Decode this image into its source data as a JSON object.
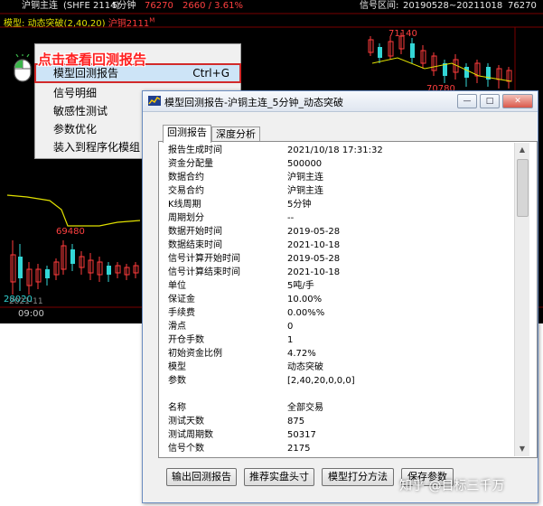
{
  "chart": {
    "symbol": "沪铜主连",
    "contract": "(SHFE 2114)",
    "period": "5分钟",
    "price": "76270",
    "change": "2660 / 3.61%",
    "signal_range_label": "信号区间:",
    "signal_range": "20190528~20211018",
    "last_price": "76270",
    "model_prefix": "模型:",
    "model_name": "动态突破(2,40,20)",
    "model_value": "沪铜2111",
    "model_suffix": "M",
    "price_high": "71140",
    "price_mid": "69480",
    "price_right_low": "70780",
    "price_bottom": "28020",
    "date_small": "2021-11",
    "time_label": "09:00"
  },
  "context_menu": {
    "items": [
      {
        "label": "模型回测报告",
        "shortcut": "Ctrl+G"
      },
      {
        "label": "信号明细",
        "shortcut": ""
      },
      {
        "label": "敏感性测试",
        "shortcut": ""
      },
      {
        "label": "参数优化",
        "shortcut": ""
      },
      {
        "label": "装入到程序化模组",
        "shortcut": ""
      }
    ]
  },
  "callout": {
    "text": "点击查看回测报告"
  },
  "window": {
    "title": "模型回测报告-沪铜主连_5分钟_动态突破",
    "tabs": [
      "回测报告",
      "深度分析"
    ],
    "rows": [
      {
        "k": "报告生成时间",
        "v": "2021/10/18 17:31:32"
      },
      {
        "k": "资金分配量",
        "v": "500000"
      },
      {
        "k": "数据合约",
        "v": "沪铜主连"
      },
      {
        "k": "交易合约",
        "v": "沪铜主连"
      },
      {
        "k": "K线周期",
        "v": "5分钟"
      },
      {
        "k": "周期划分",
        "v": "--"
      },
      {
        "k": "数据开始时间",
        "v": "2019-05-28"
      },
      {
        "k": "数据结束时间",
        "v": "2021-10-18"
      },
      {
        "k": "信号计算开始时间",
        "v": "2019-05-28"
      },
      {
        "k": "信号计算结束时间",
        "v": "2021-10-18"
      },
      {
        "k": "单位",
        "v": "5吨/手"
      },
      {
        "k": "保证金",
        "v": "10.00%"
      },
      {
        "k": "手续费",
        "v": "0.00%%"
      },
      {
        "k": "滑点",
        "v": "0"
      },
      {
        "k": "开仓手数",
        "v": "1"
      },
      {
        "k": "初始资金比例",
        "v": "4.72%"
      },
      {
        "k": "模型",
        "v": "动态突破"
      },
      {
        "k": "参数",
        "v": "[2,40,20,0,0,0]"
      },
      {
        "k": "",
        "v": ""
      },
      {
        "k": "名称",
        "v": "全部交易"
      },
      {
        "k": "测试天数",
        "v": "875"
      },
      {
        "k": "测试周期数",
        "v": "50317"
      },
      {
        "k": "信号个数",
        "v": "2175"
      }
    ],
    "buttons": [
      "输出回测报告",
      "推荐实盘头寸",
      "模型打分方法",
      "保存参数"
    ]
  },
  "watermark": "知乎 @目标三千万",
  "colors": {
    "chart_bg": "#000000",
    "up_candle": "#ff3b3b",
    "down_candle": "#33d6d6",
    "ma_line": "#e0e000",
    "highlight_border": "#d22a2a"
  }
}
